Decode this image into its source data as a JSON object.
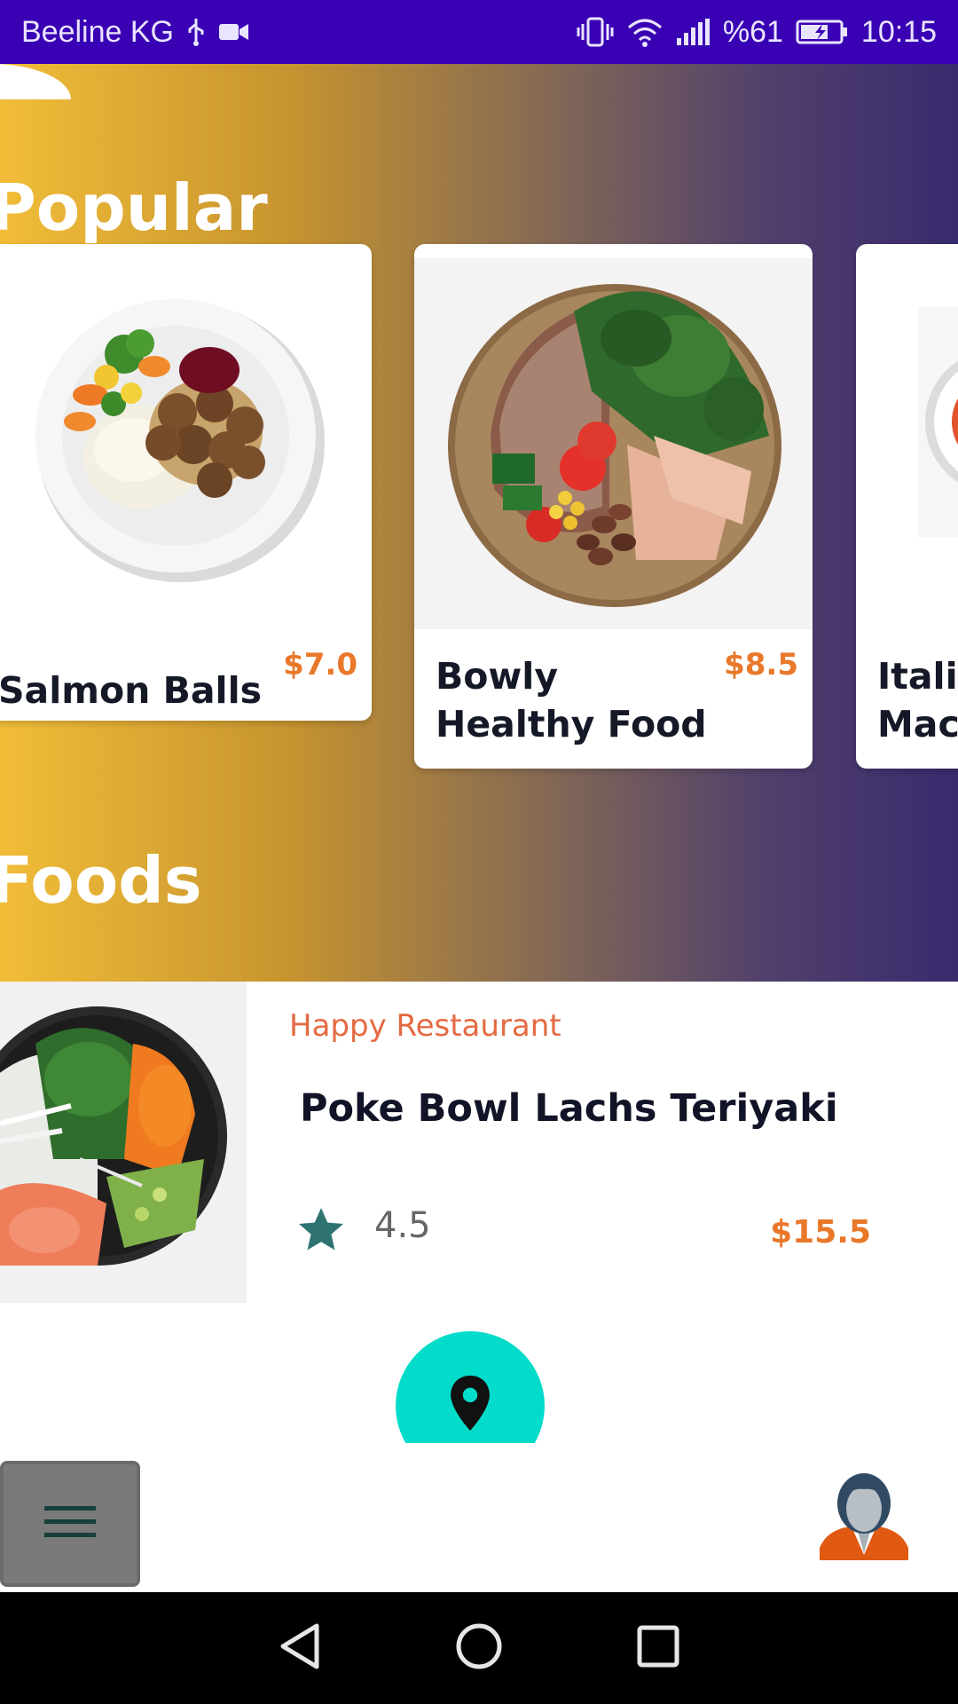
{
  "status_bar": {
    "carrier": "Beeline KG",
    "battery_percent": "%61",
    "time": "10:15",
    "icons": [
      "usb-icon",
      "video-icon",
      "vibrate-icon",
      "wifi-icon",
      "signal-icon",
      "battery-charging-icon"
    ]
  },
  "sections": {
    "popular_title": "Popular",
    "foods_title": "Foods"
  },
  "popular_cards": [
    {
      "name": "Salmon Balls",
      "price": "$7.0"
    },
    {
      "name": "Bowly\nHealthy Food",
      "name_line1": "Bowly",
      "name_line2": "Healthy Food",
      "price": "$8.5"
    },
    {
      "name_line1": "Italia",
      "name_line2": "Mac"
    }
  ],
  "food_item": {
    "restaurant": "Happy Restaurant",
    "title": "Poke Bowl Lachs Teriyaki",
    "rating": "4.5",
    "price": "$15.5"
  },
  "colors": {
    "status_bar": "#3a00b4",
    "gradient_start": "#f1bd38",
    "gradient_end": "#392a6e",
    "price": "#e9782a",
    "restaurant": "#e46a41",
    "fab": "#04dccb",
    "star": "#2f7371"
  },
  "icons": {
    "fab": "location-pin-icon",
    "menu": "hamburger-menu-icon",
    "profile": "user-avatar-icon",
    "rating": "star-icon",
    "nav": [
      "back-icon",
      "home-icon",
      "recents-icon"
    ]
  }
}
